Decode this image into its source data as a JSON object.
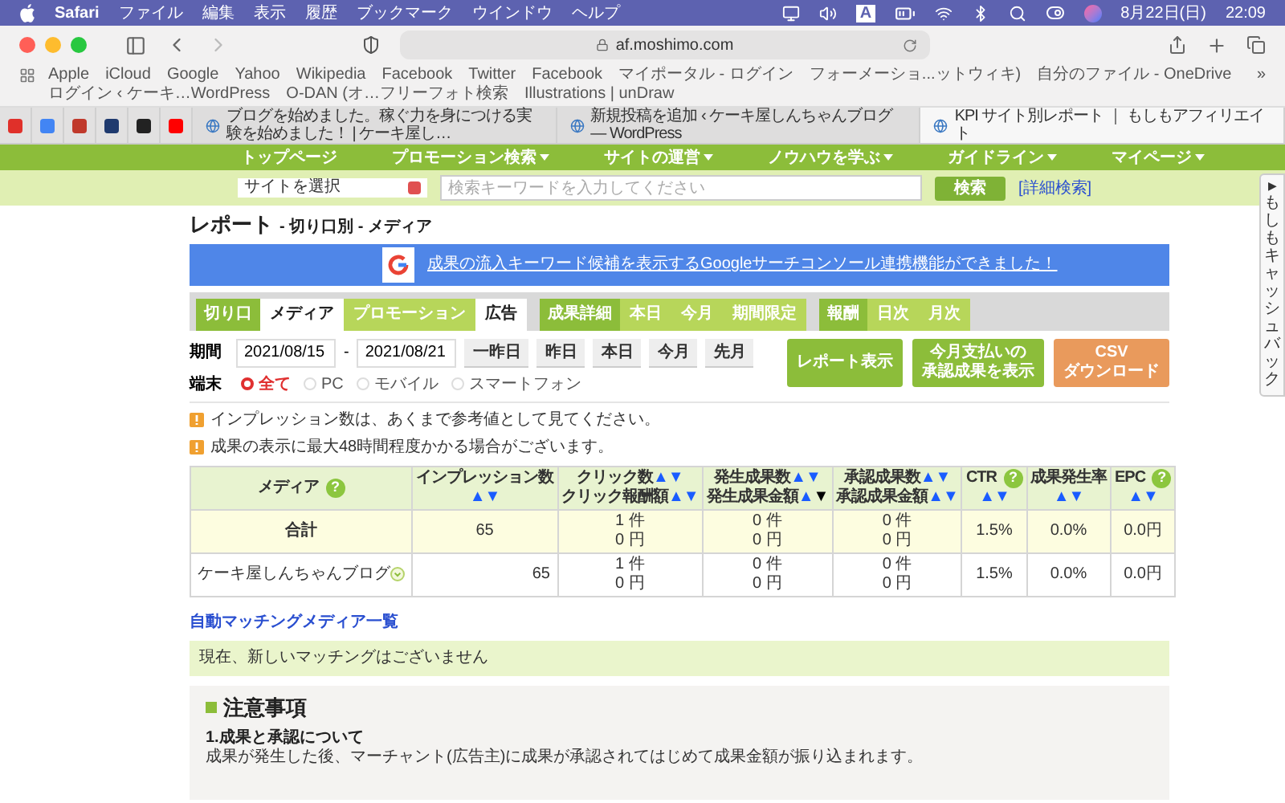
{
  "menubar": {
    "app": "Safari",
    "menus": [
      "ファイル",
      "編集",
      "表示",
      "履歴",
      "ブックマーク",
      "ウインドウ",
      "ヘルプ"
    ],
    "input_mode": "A",
    "date": "8月22日(日)",
    "time": "22:09"
  },
  "browser": {
    "url": "af.moshimo.com",
    "bookmarks": [
      "Apple",
      "iCloud",
      "Google",
      "Yahoo",
      "Wikipedia",
      "Facebook",
      "Twitter",
      "Facebook",
      "マイポータル - ログイン",
      "フォーメーショ...ットウィキ)",
      "自分のファイル - OneDrive",
      "ログイン ‹ ケーキ…WordPress",
      "O-DAN (オ…フリーフォト検索",
      "Illustrations | unDraw"
    ],
    "bookmarks_more": "»",
    "pinned_tabs": [
      {
        "color": "#e0302a"
      },
      {
        "color": "#4285f4"
      },
      {
        "color": "#c0392b"
      },
      {
        "color": "#1f3a6e"
      },
      {
        "color": "#222222"
      },
      {
        "color": "#ff0000"
      }
    ],
    "tabs": [
      {
        "title": "ブログを始めました。稼ぐ力を身につける実験を始めました！ | ケーキ屋し…",
        "selected": false
      },
      {
        "title": "新規投稿を追加 ‹ ケーキ屋しんちゃんブログ — WordPress",
        "selected": false
      },
      {
        "title": "KPI サイト別レポート ｜ もしもアフィリエイト",
        "selected": true
      }
    ]
  },
  "site_nav": {
    "items": [
      {
        "label": "トップページ",
        "dropdown": false
      },
      {
        "label": "プロモーション検索",
        "dropdown": true
      },
      {
        "label": "サイトの運営",
        "dropdown": true
      },
      {
        "label": "ノウハウを学ぶ",
        "dropdown": true
      },
      {
        "label": "ガイドライン",
        "dropdown": true
      },
      {
        "label": "マイページ",
        "dropdown": true
      }
    ]
  },
  "search": {
    "site_select": "サイトを選択",
    "placeholder": "検索キーワードを入力してください",
    "button": "検索",
    "advanced_link": "[詳細検索]"
  },
  "cashback_tab": {
    "arrow": "▶",
    "label": "もしもキャッシュバック"
  },
  "report": {
    "title": "レポート",
    "subtitle": "- 切り口別 - メディア",
    "banner": "成果の流入キーワード候補を表示するGoogleサーチコンソール連携機能ができました！",
    "tab_groups": [
      {
        "label": "切り口",
        "options": [
          {
            "label": "メディア",
            "selected": true
          },
          {
            "label": "プロモーション",
            "selected": false
          },
          {
            "label": "広告",
            "selected": true
          }
        ]
      },
      {
        "label": "成果詳細",
        "options": [
          {
            "label": "本日",
            "selected": false
          },
          {
            "label": "今月",
            "selected": false
          },
          {
            "label": "期間限定",
            "selected": false
          }
        ]
      },
      {
        "label": "報酬",
        "options": [
          {
            "label": "日次",
            "selected": false
          },
          {
            "label": "月次",
            "selected": false
          }
        ]
      }
    ],
    "period": {
      "label": "期間",
      "from": "2021/08/15",
      "separator": "-",
      "to": "2021/08/21",
      "quick_buttons": [
        "一昨日",
        "昨日",
        "本日",
        "今月",
        "先月"
      ]
    },
    "device": {
      "label": "端末",
      "options": [
        {
          "label": "全て",
          "selected": true
        },
        {
          "label": "PC",
          "selected": false
        },
        {
          "label": "モバイル",
          "selected": false
        },
        {
          "label": "スマートフォン",
          "selected": false
        }
      ]
    },
    "actions": [
      {
        "kind": "primary",
        "lines": [
          "レポート表示"
        ]
      },
      {
        "kind": "primary",
        "lines": [
          "今月支払いの",
          "承認成果を表示"
        ]
      },
      {
        "kind": "download",
        "lines": [
          "CSV",
          "ダウンロード"
        ]
      }
    ],
    "notices": [
      "インプレッション数は、あくまで参考値として見てください。",
      "成果の表示に最大48時間程度かかる場合がございます。"
    ],
    "table": {
      "columns": [
        {
          "lines": [
            {
              "text": "メディア",
              "help": "?"
            }
          ]
        },
        {
          "lines": [
            {
              "text": "インプレッション数"
            },
            {
              "asc": "▲",
              "desc": "▼",
              "asc_on": false,
              "desc_on": false
            }
          ]
        },
        {
          "lines": [
            {
              "text": "クリック数",
              "asc": "▲",
              "desc": "▼",
              "asc_on": false,
              "desc_on": false
            },
            {
              "text": "クリック報酬額",
              "asc": "▲",
              "desc": "▼",
              "asc_on": false,
              "desc_on": false
            }
          ]
        },
        {
          "lines": [
            {
              "text": "発生成果数",
              "asc": "▲",
              "desc": "▼",
              "asc_on": false,
              "desc_on": false
            },
            {
              "text": "発生成果金額",
              "asc": "▲",
              "desc": "▼",
              "asc_on": false,
              "desc_on": true
            }
          ]
        },
        {
          "lines": [
            {
              "text": "承認成果数",
              "asc": "▲",
              "desc": "▼",
              "asc_on": false,
              "desc_on": false
            },
            {
              "text": "承認成果金額",
              "asc": "▲",
              "desc": "▼",
              "asc_on": false,
              "desc_on": false
            }
          ]
        },
        {
          "lines": [
            {
              "text": "CTR",
              "help": "?"
            },
            {
              "asc": "▲",
              "desc": "▼",
              "asc_on": false,
              "desc_on": false
            }
          ]
        },
        {
          "lines": [
            {
              "text": "成果発生率"
            },
            {
              "asc": "▲",
              "desc": "▼",
              "asc_on": false,
              "desc_on": false
            }
          ]
        },
        {
          "lines": [
            {
              "text": "EPC",
              "help": "?"
            },
            {
              "asc": "▲",
              "desc": "▼",
              "asc_on": false,
              "desc_on": false
            }
          ]
        }
      ],
      "rows": [
        {
          "kind": "total",
          "cells": [
            [
              "合計"
            ],
            [
              "65"
            ],
            [
              "1 件",
              "0 円"
            ],
            [
              "0 件",
              "0 円"
            ],
            [
              "0 件",
              "0 円"
            ],
            [
              "1.5%"
            ],
            [
              "0.0%"
            ],
            [
              "0.0円"
            ]
          ]
        },
        {
          "kind": "media",
          "cells": [
            [
              "ケーキ屋しんちゃんブログ"
            ],
            [
              "65"
            ],
            [
              "1 件",
              "0 円"
            ],
            [
              "0 件",
              "0 円"
            ],
            [
              "0 件",
              "0 円"
            ],
            [
              "1.5%"
            ],
            [
              "0.0%"
            ],
            [
              "0.0円"
            ]
          ]
        }
      ]
    },
    "matching": {
      "link": "自動マッチングメディア一覧",
      "message": "現在、新しいマッチングはございません"
    },
    "notes": {
      "heading": "注意事項",
      "items": [
        {
          "title": "1.成果と承認について",
          "text": "成果が発生した後、マーチャント(広告主)に成果が承認されてはじめて成果金額が振り込まれます。"
        }
      ]
    }
  }
}
